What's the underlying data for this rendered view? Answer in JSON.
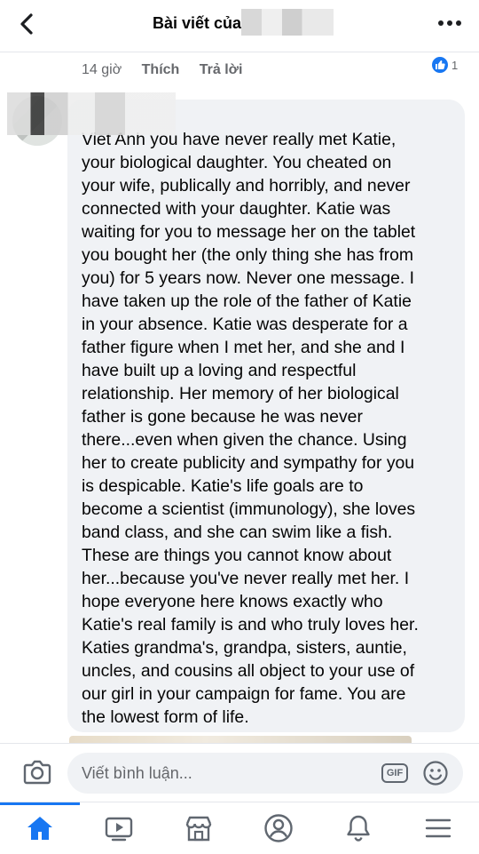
{
  "header": {
    "title": "Bài viết của"
  },
  "previous_comment": {
    "time": "14 giờ",
    "like_label": "Thích",
    "reply_label": "Trả lời",
    "reaction_count": "1"
  },
  "comment": {
    "text": "Viet Anh you have never really met Katie,\nyour biological daughter. You cheated on\nyour wife, publically and horribly, and never\nconnected with your daughter.  Katie was\nwaiting for you to message her on the tablet\nyou bought her (the only thing she has from\nyou) for 5 years now.  Never one message.  I\nhave taken up the role of the father of Katie\nin your absence.  Katie was desperate for a\nfather figure when I met her, and she and I\nhave built up a loving and respectful\nrelationship.  Her memory of her biological\nfather is gone because he was never\nthere...even when given the chance.  Using\nher to create publicity and sympathy for you\nis despicable.  Katie's life goals are to\nbecome a scientist (immunology), she loves\nband class, and she can swim like a fish.\nThese are things you cannot know about\nher...because you've never really met her.  I\nhope everyone here knows exactly who\nKatie's real family is and who truly loves her.\nKaties grandma's, grandpa, sisters, auntie,\nuncles, and cousins all object to your use of\nour girl in your campaign for fame.  You are\nthe lowest form of life."
  },
  "composer": {
    "placeholder": "Viết bình luận...",
    "gif_label": "GIF"
  },
  "tabbar": {
    "items": [
      "home-icon",
      "video-icon",
      "marketplace-icon",
      "profile-icon",
      "notifications-icon",
      "menu-icon"
    ],
    "active": "home-icon"
  },
  "colors": {
    "accent": "#1877f2",
    "bubble": "#f0f2f5",
    "secondary_text": "#65676b"
  }
}
